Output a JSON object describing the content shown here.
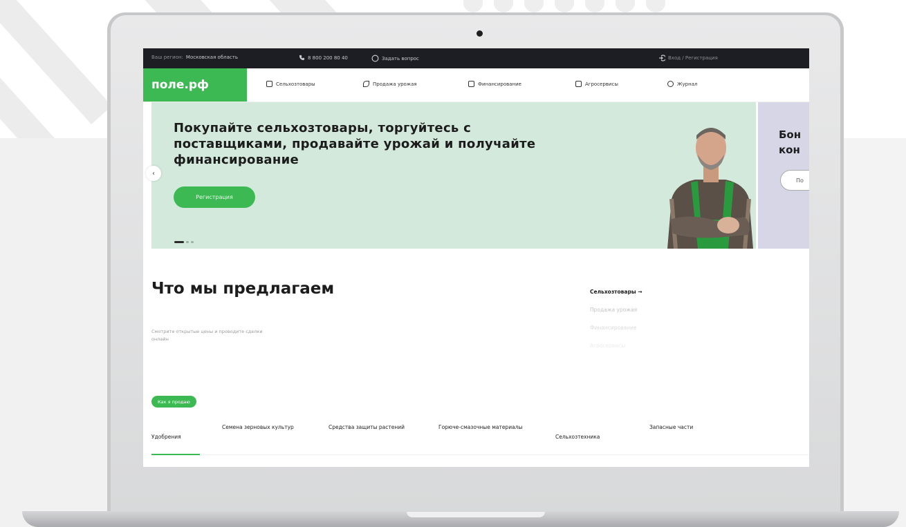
{
  "colors": {
    "brand_green": "#3db954",
    "hero_bg": "#d2e9db",
    "topbar_bg": "#1d1e24",
    "next_slide_bg": "#d6d6e6"
  },
  "topbar": {
    "region_label": "Ваш регион:",
    "region_value": "Московская область",
    "phone": "8 800 200 80 40",
    "ask_question": "Задать вопрос",
    "login": "Вход / Регистрация"
  },
  "header": {
    "logo": "поле.рф",
    "nav": [
      {
        "label": "Сельхозтовары",
        "icon": "grid-icon"
      },
      {
        "label": "Продажа урожая",
        "icon": "sprout-icon"
      },
      {
        "label": "Финансирование",
        "icon": "finance-icon"
      },
      {
        "label": "Агросервисы",
        "icon": "services-icon"
      },
      {
        "label": "Журнал",
        "icon": "book-icon"
      }
    ]
  },
  "hero": {
    "title": "Покупайте сельхозтовары, торгуйтесь с поставщиками, продавайте урожай и получайте финансирование",
    "button": "Регистрация",
    "prev_arrow": "‹",
    "next_title_line1": "Бон",
    "next_title_line2": "кон",
    "next_button": "По"
  },
  "offer": {
    "title": "Что мы предлагаем",
    "description": "Смотрите открытые цены и проводите сделки онлайн",
    "menu": [
      {
        "label": "Сельхозтовары →",
        "active": true
      },
      {
        "label": "Продажа урожая",
        "active": false
      },
      {
        "label": "Финансирование",
        "active": false
      },
      {
        "label": "Агросервисы",
        "active": false
      }
    ]
  },
  "catalog": {
    "badge": "Как я продаю",
    "tabs": [
      {
        "label": "Удобрения",
        "active": true
      },
      {
        "label": "Семена зерновых культур",
        "active": false
      },
      {
        "label": "Средства защиты растений",
        "active": false
      },
      {
        "label": "Горюче-смазочные материалы",
        "active": false
      },
      {
        "label": "Сельхозтехника",
        "active": false
      },
      {
        "label": "Запасные части",
        "active": false
      }
    ]
  }
}
